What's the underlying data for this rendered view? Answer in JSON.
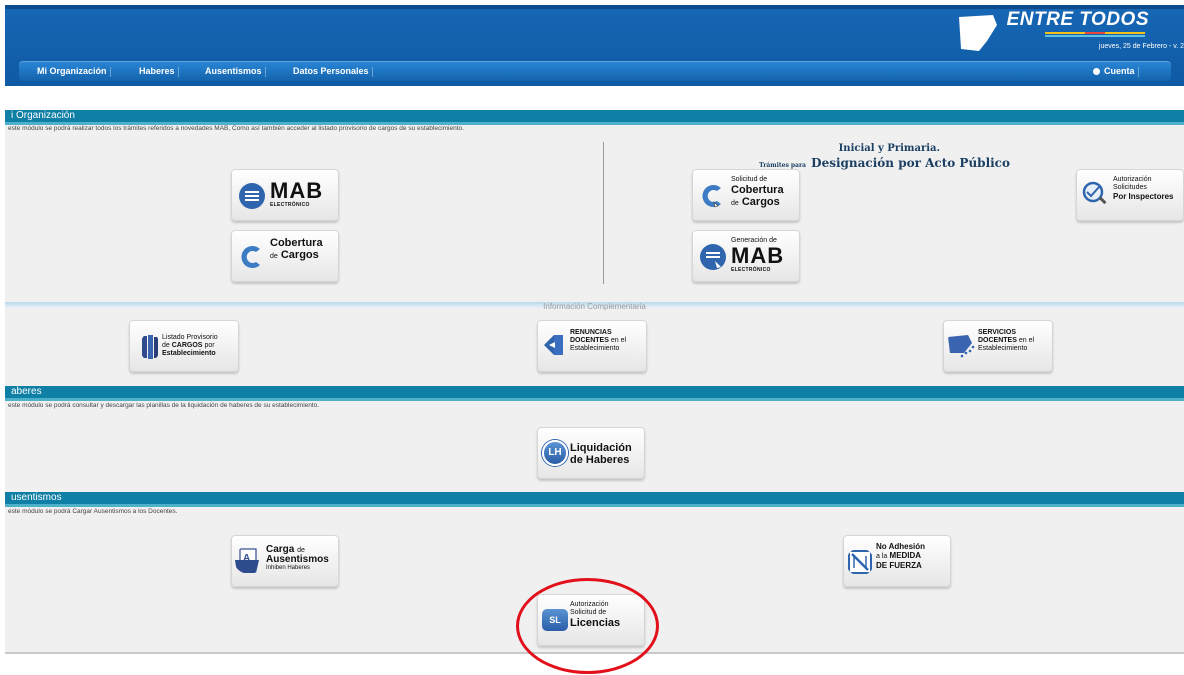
{
  "header": {
    "brand": "ENTRE TODOS",
    "date": "jueves, 25 de Febrero - v. 2",
    "nav": [
      "Mi Organización",
      "Haberes",
      "Ausentismos",
      "Datos Personales"
    ],
    "account": "Cuenta",
    "colors": {
      "primary": "#1767b6",
      "band": "#0f7fa5"
    }
  },
  "sections": {
    "organizacion": {
      "title": "i Organización",
      "description": "este módulo se podrá realizar todos los trámites referidos a novedades MAB, Como así también acceder al listado provisorio de cargos de su establecimiento.",
      "right_heading_top": "Inicial y Primaria.",
      "right_heading_small": "Trámites para",
      "right_heading_big": "Designación por Acto Público",
      "tiles": {
        "mab": {
          "big": "MAB",
          "small": "ELECTRÓNICO"
        },
        "cobertura": {
          "line1": "Cobertura",
          "prefix": "de",
          "line2": "Cargos"
        },
        "solicitud": {
          "top": "Solicitud de",
          "mid": "Cobertura",
          "prefix": "de",
          "bottom": "Cargos"
        },
        "generacion": {
          "top": "Generación de",
          "big": "MAB",
          "small": "ELECTRÓNICO"
        },
        "autorizacion_insp": {
          "line1": "Autorización",
          "line2": "Solicitudes",
          "line3": "Por Inspectores"
        }
      },
      "complementaria": {
        "title": "Información Complementaria",
        "listado": {
          "line1": "Listado Provisorio",
          "line2a": "de",
          "line2b": "CARGOS",
          "line2c": "por",
          "line3": "Establecimiento"
        },
        "renuncias": {
          "line1": "RENUNCIAS",
          "line2a": "DOCENTES",
          "line2b": "en el",
          "line3": "Establecimiento"
        },
        "servicios": {
          "line1": "SERVICIOS",
          "line2a": "DOCENTES",
          "line2b": "en el",
          "line3": "Establecimiento"
        }
      }
    },
    "haberes": {
      "title": "aberes",
      "description": "este módulo se podrá consultar y descargar las planillas de la liquidación de haberes de su establecimiento.",
      "liquidacion": {
        "icon": "LH",
        "line1": "Liquidación",
        "line2": "de Haberes"
      }
    },
    "ausentismos": {
      "title": "usentismos",
      "description": "este módulo se podrá Cargar Ausentismos a los Docentes.",
      "carga": {
        "line1a": "Carga",
        "line1b": "de",
        "line2": "Ausentismos",
        "line3": "Inhiben Haberes"
      },
      "no_adhesion": {
        "line1": "No Adhesión",
        "line2a": "a la",
        "line2b": "MEDIDA",
        "line3": "DE FUERZA"
      },
      "licencias": {
        "icon": "SL",
        "line1": "Autorización",
        "line2": "Solicitud de",
        "line3": "Licencias"
      }
    }
  }
}
